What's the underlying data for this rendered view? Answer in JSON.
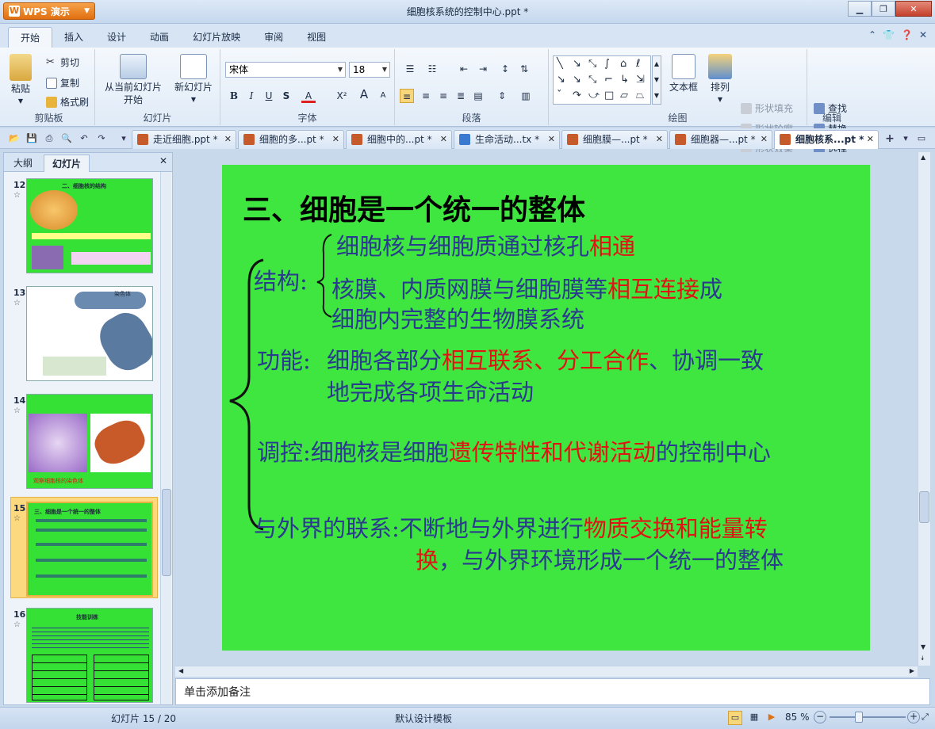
{
  "app": {
    "button_label": "WPS 演示",
    "window_title": "细胞核系统的控制中心.ppt *"
  },
  "menu": {
    "tabs": [
      "开始",
      "插入",
      "设计",
      "动画",
      "幻灯片放映",
      "审阅",
      "视图"
    ]
  },
  "ribbon": {
    "clipboard": {
      "group_label": "剪贴板",
      "paste": "粘贴",
      "cut": "剪切",
      "copy": "复制",
      "format_painter": "格式刷"
    },
    "slides": {
      "group_label": "幻灯片",
      "from_current_line1": "从当前幻灯片",
      "from_current_line2": "开始",
      "new_slide": "新幻灯片"
    },
    "font": {
      "group_label": "字体",
      "font_name": "宋体",
      "font_size": "18",
      "bold": "B",
      "italic": "I",
      "underline": "U",
      "shadow": "S",
      "color": "A",
      "super": "X²",
      "grow": "A",
      "shrink": "A"
    },
    "paragraph": {
      "group_label": "段落"
    },
    "drawing": {
      "group_label": "绘图",
      "textbox": "文本框",
      "arrange": "排列",
      "fill": "形状填充",
      "outline": "形状轮廓",
      "effects": "形状效果"
    },
    "editing": {
      "group_label": "编辑",
      "find": "查找",
      "replace": "替换",
      "select": "选择"
    }
  },
  "doc_tabs": [
    {
      "label": "走近细胞.ppt *"
    },
    {
      "label": "细胞的多...pt *"
    },
    {
      "label": "细胞中的...pt *"
    },
    {
      "label": "生命活动...tx *"
    },
    {
      "label": "细胞膜—...pt *"
    },
    {
      "label": "细胞器—...pt *"
    },
    {
      "label": "细胞核系...pt *"
    }
  ],
  "panel": {
    "tab_outline": "大纲",
    "tab_slides": "幻灯片"
  },
  "thumbnails": [
    {
      "number": "12",
      "caption": "二、细胞核的结构"
    },
    {
      "number": "13",
      "caption": "染色体"
    },
    {
      "number": "14",
      "caption": "观察细胞核的染色体"
    },
    {
      "number": "15",
      "caption": "三、细胞是一个统一的整体"
    },
    {
      "number": "16",
      "caption": "技能训练"
    }
  ],
  "slide": {
    "title": "三、细胞是一个统一的整体",
    "structure_label": "结构:",
    "structure_line1_a": "细胞核与细胞质通过核孔",
    "structure_line1_red": "相通",
    "structure_line2_a": "核膜、内质网膜与细胞膜等",
    "structure_line2_red": "相互连接",
    "structure_line2_b": "成",
    "structure_line3": "细胞内完整的生物膜系统",
    "function_label": "功能:",
    "function_a": "细胞各部分",
    "function_red": "相互联系、分工合作",
    "function_b": "、协调一致",
    "function_line2": "地完成各项生命活动",
    "control_label": "调控:",
    "control_a": "细胞核是细胞",
    "control_red": "遗传特性和代谢活动",
    "control_b": "的控制中心",
    "link_label": "与外界的联系:",
    "link_a": "不断地与外界进行",
    "link_red1": "物质交换和能量转",
    "link_red2": "换",
    "link_b": "，与外界环境形成一个统一的整体"
  },
  "notes": {
    "placeholder": "单击添加备注"
  },
  "status": {
    "slide_counter": "幻灯片 15 / 20",
    "template": "默认设计模板",
    "zoom": "85 %"
  },
  "colors": {
    "slide_bg": "#3fe640",
    "highlight_text": "#e01414",
    "body_text": "#2a3a8e"
  }
}
